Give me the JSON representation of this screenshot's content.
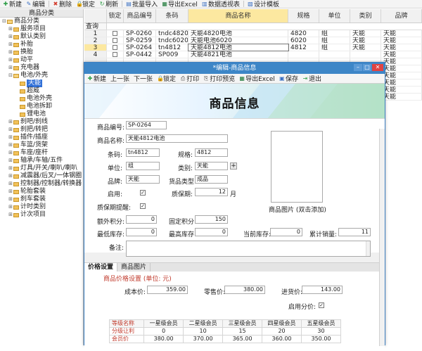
{
  "toolbar": {
    "items": [
      {
        "icon": "add-icon",
        "glyph": "✚",
        "color": "#2e9e46",
        "label": "新建"
      },
      {
        "icon": "edit-icon",
        "glyph": "✎",
        "color": "#3a6fc2",
        "label": "编辑"
      },
      {
        "icon": "delete-icon",
        "glyph": "✖",
        "color": "#d33b2c",
        "label": "删除"
      },
      {
        "icon": "lock-icon",
        "glyph": "🔒",
        "color": "#c48a1a",
        "label": "锁定"
      },
      {
        "icon": "refresh-icon",
        "glyph": "↻",
        "color": "#2e9e46",
        "label": "刷新"
      },
      {
        "icon": "import-icon",
        "glyph": "▤",
        "color": "#3a6fc2",
        "label": "批量导入"
      },
      {
        "icon": "excel-icon",
        "glyph": "▦",
        "color": "#1f7a3a",
        "label": "导出Excel"
      },
      {
        "icon": "pivot-icon",
        "glyph": "▥",
        "color": "#3a6fc2",
        "label": "数据透视表"
      },
      {
        "icon": "template-icon",
        "glyph": "▧",
        "color": "#3a6fc2",
        "label": "设计模板"
      }
    ]
  },
  "tree": {
    "header": "商品分类",
    "items": [
      {
        "label": "商品分类",
        "level": 0,
        "exp": "⊟"
      },
      {
        "label": "服务项目",
        "level": 1,
        "exp": "⊞"
      },
      {
        "label": "默认类别",
        "level": 1,
        "exp": "⊞"
      },
      {
        "label": "补胎",
        "level": 1,
        "exp": "⊞"
      },
      {
        "label": "换胎",
        "level": 1,
        "exp": "⊞"
      },
      {
        "label": "动平",
        "level": 1,
        "exp": "⊞"
      },
      {
        "label": "充电器",
        "level": 1,
        "exp": "⊞"
      },
      {
        "label": "电池/外壳",
        "level": 1,
        "exp": "⊟"
      },
      {
        "label": "天能",
        "level": 2,
        "exp": "",
        "selected": true
      },
      {
        "label": "超威",
        "level": 2,
        "exp": ""
      },
      {
        "label": "电池外壳",
        "level": 2,
        "exp": ""
      },
      {
        "label": "电池拆卸",
        "level": 2,
        "exp": ""
      },
      {
        "label": "锂电池",
        "level": 2,
        "exp": ""
      },
      {
        "label": "刹吧/刹线",
        "level": 1,
        "exp": "⊞"
      },
      {
        "label": "刹把/转把",
        "level": 1,
        "exp": "⊞"
      },
      {
        "label": "插件/插座",
        "level": 1,
        "exp": "⊞"
      },
      {
        "label": "车篮/货架",
        "level": 1,
        "exp": "⊞"
      },
      {
        "label": "车座/座杆",
        "level": 1,
        "exp": "⊞"
      },
      {
        "label": "轴承/车轴/五件",
        "level": 1,
        "exp": "⊞"
      },
      {
        "label": "灯具/开关/喇叭/喇叭",
        "level": 1,
        "exp": "⊞"
      },
      {
        "label": "减震器/后叉/一体钢圈",
        "level": 1,
        "exp": "⊞"
      },
      {
        "label": "控制器/控制器/转换器",
        "level": 1,
        "exp": "⊞"
      },
      {
        "label": "轮胎套装",
        "level": 1,
        "exp": "⊞"
      },
      {
        "label": "刹车套装",
        "level": 1,
        "exp": "⊞"
      },
      {
        "label": "计时类别",
        "level": 1,
        "exp": "⊞"
      },
      {
        "label": "计次项目",
        "level": 1,
        "exp": "⊞"
      }
    ]
  },
  "grid": {
    "columns": [
      "锁定",
      "商品编号",
      "条码",
      "商品名称",
      "规格",
      "单位",
      "类别",
      "品牌"
    ],
    "filter_label": "查询",
    "rows": [
      {
        "n": "1",
        "code": "SP-0260",
        "barcode": "tndc4820",
        "name": "天能4820电池",
        "spec": "4820",
        "unit": "组",
        "cat": "天能",
        "brand": "天能"
      },
      {
        "n": "2",
        "code": "SP-0259",
        "barcode": "tndc6020",
        "name": "天能电池6020",
        "spec": "6020",
        "unit": "组",
        "cat": "天能",
        "brand": "天能"
      },
      {
        "n": "3",
        "code": "SP-0264",
        "barcode": "tn4812",
        "name": "天能4812电池",
        "spec": "4812",
        "unit": "组",
        "cat": "天能",
        "brand": "天能"
      },
      {
        "n": "4",
        "code": "SP-0442",
        "barcode": "SP009",
        "name": "天能4821电池",
        "spec": "",
        "unit": "",
        "cat": "",
        "brand": "天能"
      },
      {
        "n": "",
        "code": "",
        "barcode": "",
        "name": "",
        "spec": "",
        "unit": "",
        "cat": "",
        "brand": "天能"
      },
      {
        "n": "",
        "code": "",
        "barcode": "",
        "name": "",
        "spec": "",
        "unit": "",
        "cat": "",
        "brand": "天能"
      },
      {
        "n": "",
        "code": "",
        "barcode": "",
        "name": "",
        "spec": "",
        "unit": "",
        "cat": "",
        "brand": "天能"
      },
      {
        "n": "",
        "code": "",
        "barcode": "",
        "name": "",
        "spec": "",
        "unit": "",
        "cat": "",
        "brand": "天能"
      },
      {
        "n": "",
        "code": "",
        "barcode": "",
        "name": "",
        "spec": "",
        "unit": "",
        "cat": "",
        "brand": "天能"
      },
      {
        "n": "",
        "code": "",
        "barcode": "",
        "name": "",
        "spec": "",
        "unit": "",
        "cat": "",
        "brand": "天能"
      }
    ]
  },
  "modal": {
    "title": "*编辑-商品信息",
    "toolbar": [
      {
        "icon": "add-icon",
        "glyph": "✚",
        "color": "#2e9e46",
        "label": "新建"
      },
      {
        "icon": "prev-icon",
        "glyph": "",
        "color": "#333",
        "label": "上一张"
      },
      {
        "icon": "next-icon",
        "glyph": "",
        "color": "#333",
        "label": "下一张"
      },
      {
        "icon": "lock-icon",
        "glyph": "🔒",
        "color": "#c48a1a",
        "label": "锁定"
      },
      {
        "icon": "print-icon",
        "glyph": "⎙",
        "color": "#555",
        "label": "打印"
      },
      {
        "icon": "print-preview-icon",
        "glyph": "⎘",
        "color": "#555",
        "label": "打印预览"
      },
      {
        "icon": "excel-icon",
        "glyph": "▦",
        "color": "#1f7a3a",
        "label": "导出Excel"
      },
      {
        "icon": "save-icon",
        "glyph": "▣",
        "color": "#3a6fc2",
        "label": "保存"
      },
      {
        "icon": "exit-icon",
        "glyph": "⇥",
        "color": "#2e9e46",
        "label": "退出"
      }
    ],
    "banner_title": "商品信息",
    "form": {
      "code_label": "商品编号:",
      "code": "SP-0264",
      "name_label": "商品名称:",
      "name": "天能4812电池",
      "barcode_label": "条码:",
      "barcode": "tn4812",
      "spec_label": "规格:",
      "spec": "4812",
      "unit_label": "单位:",
      "unit": "组",
      "cat_label": "类别:",
      "cat": "天能",
      "brand_label": "品牌:",
      "brand": "天能",
      "ptype_label": "货品类型:",
      "ptype": "成品",
      "enabled_label": "启用:",
      "warranty_label": "质保期:",
      "warranty": "12",
      "warranty_unit": "月",
      "warranty_alert_label": "质保期提醒:",
      "image_label": "商品图片 (双击添加)",
      "extra_points_label": "额外积分:",
      "extra_points": "0",
      "fixed_points_label": "固定积分:",
      "fixed_points": "150",
      "min_stock_label": "最低库存:",
      "min_stock": "0",
      "max_stock_label": "最高库存:",
      "max_stock": "0",
      "cur_stock_label": "当前库存:",
      "cur_stock": "0",
      "total_sales_label": "累计销量:",
      "total_sales": "11",
      "note_label": "备注:"
    },
    "tabs": [
      "价格设置",
      "商品图片"
    ],
    "price": {
      "title": "商品价格设置 (单位: 元)",
      "cost_label": "成本价:",
      "cost": "359.00",
      "retail_label": "零售价:",
      "retail": "380.00",
      "purchase_label": "进货价:",
      "purchase": "143.00",
      "tier_label": "启用分价:",
      "table": {
        "headers": [
          "等级名称",
          "一星级会员",
          "二星级会员",
          "三星级会员",
          "四星级会员",
          "五星级会员"
        ],
        "rows": [
          [
            "分级让利",
            "0",
            "10",
            "15",
            "20",
            "30"
          ],
          [
            "会员价",
            "380.00",
            "370.00",
            "365.00",
            "360.00",
            "350.00"
          ]
        ]
      }
    }
  }
}
